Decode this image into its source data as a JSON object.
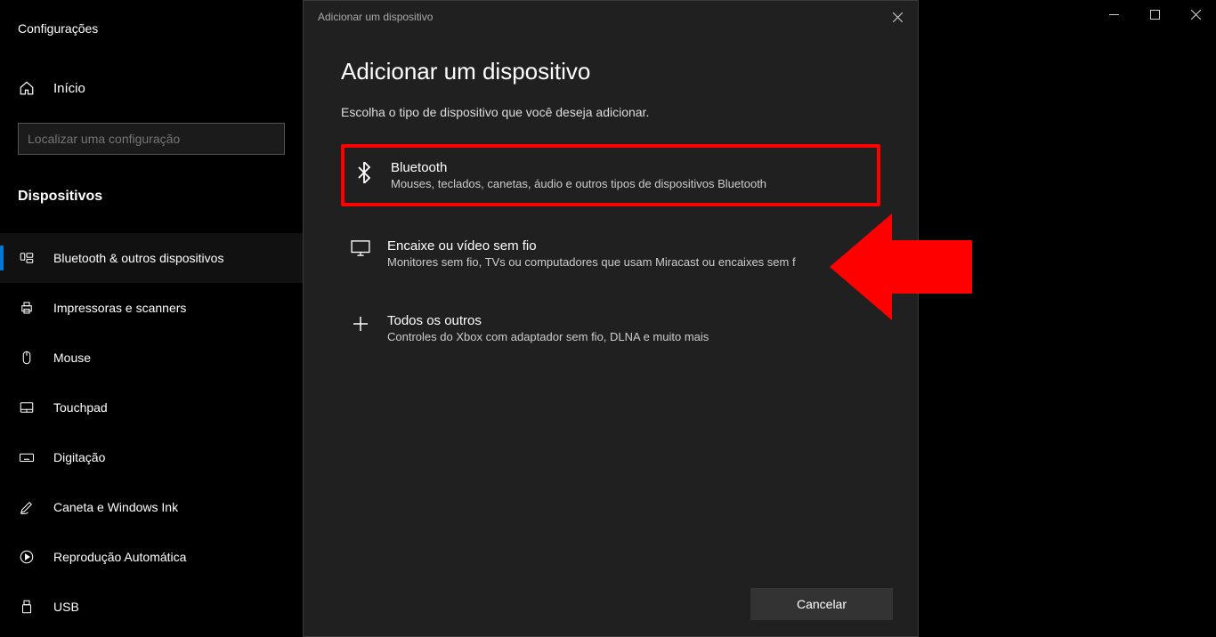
{
  "app_title": "Configurações",
  "home_label": "Início",
  "search_placeholder": "Localizar uma configuração",
  "category_title": "Dispositivos",
  "nav_items": [
    {
      "label": "Bluetooth & outros dispositivos"
    },
    {
      "label": "Impressoras e scanners"
    },
    {
      "label": "Mouse"
    },
    {
      "label": "Touchpad"
    },
    {
      "label": "Digitação"
    },
    {
      "label": "Caneta e Windows Ink"
    },
    {
      "label": "Reprodução Automática"
    },
    {
      "label": "USB"
    }
  ],
  "dialog": {
    "titlebar": "Adicionar um dispositivo",
    "heading": "Adicionar um dispositivo",
    "subheading": "Escolha o tipo de dispositivo que você deseja adicionar.",
    "options": [
      {
        "title": "Bluetooth",
        "desc": "Mouses, teclados, canetas, áudio e outros tipos de dispositivos Bluetooth"
      },
      {
        "title": "Encaixe ou vídeo sem fio",
        "desc": "Monitores sem fio, TVs ou computadores que usam Miracast ou encaixes sem f"
      },
      {
        "title": "Todos os outros",
        "desc": "Controles do Xbox com adaptador sem fio, DLNA e muito mais"
      }
    ],
    "cancel_label": "Cancelar"
  }
}
